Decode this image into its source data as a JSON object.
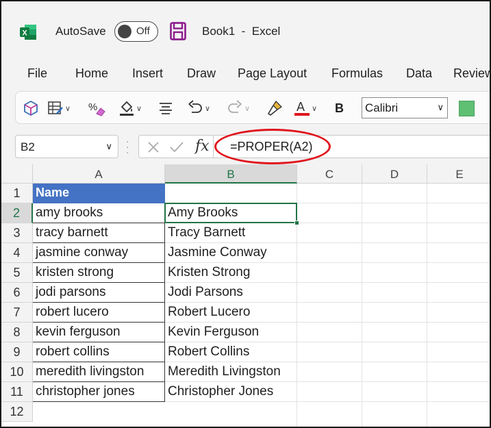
{
  "titlebar": {
    "autosave_label": "AutoSave",
    "autosave_state": "Off",
    "document_title": "Book1  -  Excel"
  },
  "menu": [
    "File",
    "Home",
    "Insert",
    "Draw",
    "Page Layout",
    "Formulas",
    "Data",
    "Review"
  ],
  "toolbar": {
    "font_name": "Calibri",
    "bold_label": "B",
    "font_color_letter": "A",
    "font_color": "#e0141c",
    "fill_color": "#5fbf73"
  },
  "formula_bar": {
    "name_box": "B2",
    "fx_label": "fx",
    "formula": "=PROPER(A2)"
  },
  "grid": {
    "columns": [
      "A",
      "B",
      "C",
      "D",
      "E"
    ],
    "rows": [
      "1",
      "2",
      "3",
      "4",
      "5",
      "6",
      "7",
      "8",
      "9",
      "10",
      "11",
      "12"
    ],
    "header_cell": "Name",
    "column_a": [
      "amy brooks",
      "tracy barnett",
      "jasmine conway",
      "kristen strong",
      "jodi parsons",
      "robert lucero",
      "kevin ferguson",
      "robert collins",
      "meredith livingston",
      "christopher jones"
    ],
    "column_b": [
      "Amy Brooks",
      "Tracy Barnett",
      "Jasmine Conway",
      "Kristen Strong",
      "Jodi Parsons",
      "Robert Lucero",
      "Kevin Ferguson",
      "Robert Collins",
      "Meredith Livingston",
      "Christopher Jones"
    ],
    "selected_cell": "B2",
    "header_fill": "#4472c4",
    "accent": "#217346"
  }
}
